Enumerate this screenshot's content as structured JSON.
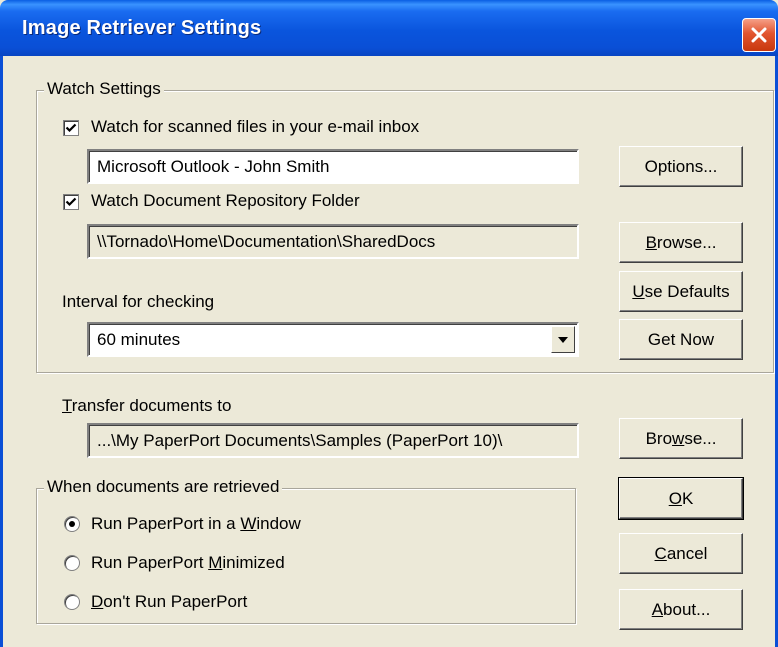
{
  "window": {
    "title": "Image Retriever Settings"
  },
  "watch_settings": {
    "legend": "Watch Settings",
    "email_checkbox": {
      "checked": true,
      "label": "Watch for scanned files in your e-mail inbox"
    },
    "email_value": "Microsoft Outlook - John Smith",
    "options_button": "Options...",
    "repo_checkbox": {
      "checked": true,
      "label": "Watch Document Repository Folder"
    },
    "repo_value": "\\\\Tornado\\Home\\Documentation\\SharedDocs",
    "browse_button": {
      "pre": "",
      "mnemonic": "B",
      "post": "rowse..."
    },
    "use_defaults_button": {
      "pre": "",
      "mnemonic": "U",
      "post": "se Defaults"
    },
    "interval_label": "Interval for checking",
    "interval_value": "60 minutes",
    "get_now_button": "Get Now"
  },
  "transfer": {
    "label": {
      "pre": "",
      "mnemonic": "T",
      "post": "ransfer documents to"
    },
    "value": "...\\My PaperPort Documents\\Samples (PaperPort 10)\\",
    "browse_button": {
      "pre": "Bro",
      "mnemonic": "w",
      "post": "se..."
    }
  },
  "retrieved": {
    "legend": "When documents are retrieved",
    "options": [
      {
        "selected": true,
        "pre": "Run PaperPort in a ",
        "mnemonic": "W",
        "post": "indow"
      },
      {
        "selected": false,
        "pre": "Run PaperPort ",
        "mnemonic": "M",
        "post": "inimized"
      },
      {
        "selected": false,
        "pre": "",
        "mnemonic": "D",
        "post": "on't Run PaperPort"
      }
    ]
  },
  "buttons": {
    "ok": {
      "pre": "",
      "mnemonic": "O",
      "post": "K"
    },
    "cancel": {
      "pre": "",
      "mnemonic": "C",
      "post": "ancel"
    },
    "about": {
      "pre": "",
      "mnemonic": "A",
      "post": "bout..."
    }
  },
  "icons": {
    "close": "close-icon",
    "check": "checkmark-icon",
    "dropdown": "dropdown-arrow-icon"
  }
}
